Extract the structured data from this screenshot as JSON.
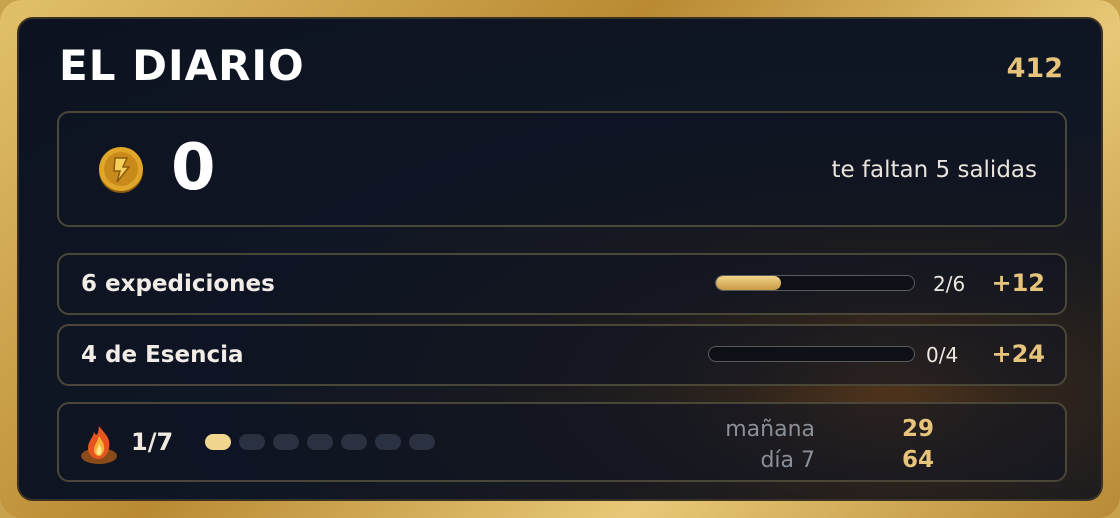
{
  "header": {
    "title": "EL DIARIO",
    "count": "412"
  },
  "balance": {
    "coin_icon": "coin-icon",
    "value": "0",
    "remaining_text": "te faltan 5 salidas"
  },
  "quests": [
    {
      "label": "6 expediciones",
      "progress_text": "2/6",
      "progress": 0.33,
      "reward": "+12"
    },
    {
      "label": "4 de Esencia",
      "progress_text": "0/4",
      "progress": 0.0,
      "reward": "+24"
    }
  ],
  "streak": {
    "flame_icon": "flame-icon",
    "count": "1/7",
    "days_total": 7,
    "days_done": 1,
    "next_labels": [
      "mañana",
      "día 7"
    ],
    "next_values": [
      "29",
      "64"
    ]
  },
  "colors": {
    "accent_gold": "#e6c47c",
    "panel_bg": "#0f1624",
    "frame_gold": "#c9a24e"
  }
}
